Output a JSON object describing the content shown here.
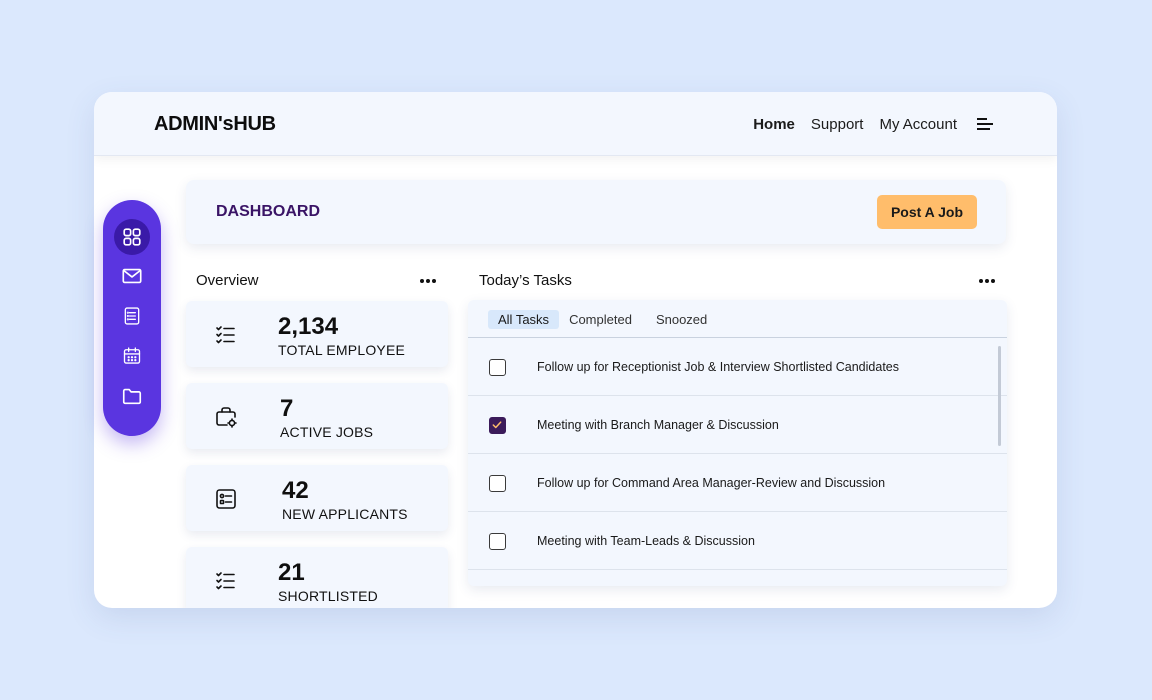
{
  "app": {
    "logo": "ADMIN'sHUB"
  },
  "nav": {
    "items": [
      "Home",
      "Support",
      "My Account"
    ],
    "active": "Home"
  },
  "sidebar": {
    "items": [
      "dashboard-grid-icon",
      "mail-icon",
      "receipt-list-icon",
      "calendar-icon",
      "folder-icon"
    ],
    "active_index": 0
  },
  "header": {
    "title": "DASHBOARD",
    "post_job_label": "Post A Job"
  },
  "overview": {
    "label": "Overview",
    "stats": [
      {
        "value": "2,134",
        "label": "TOTAL EMPLOYEE",
        "icon": "checklist-icon"
      },
      {
        "value": "7",
        "label": "ACTIVE JOBS",
        "icon": "briefcase-gear-icon"
      },
      {
        "value": "42",
        "label": "NEW APPLICANTS",
        "icon": "applicant-form-icon"
      },
      {
        "value": "21",
        "label": "SHORTLISTED",
        "icon": "checklist-icon"
      }
    ]
  },
  "tasks": {
    "label": "Today’s Tasks",
    "tabs": [
      "All Tasks",
      "Completed",
      "Snoozed"
    ],
    "active_tab": "All Tasks",
    "items": [
      {
        "text": "Follow up for Receptionist Job & Interview Shortlisted Candidates",
        "checked": false
      },
      {
        "text": "Meeting with Branch Manager & Discussion",
        "checked": true
      },
      {
        "text": "Follow up for Command Area Manager-Review and Discussion",
        "checked": false
      },
      {
        "text": "Meeting with Team-Leads & Discussion",
        "checked": false
      }
    ]
  },
  "colors": {
    "accent": "#5a35e0",
    "button": "#ffbd6b",
    "title": "#3a1466",
    "check": "#3b1b5a",
    "background": "#dbe8fd"
  }
}
